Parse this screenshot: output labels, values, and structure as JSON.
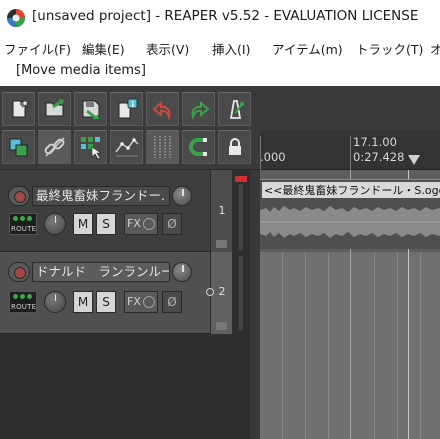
{
  "window": {
    "title": "[unsaved project] - REAPER v5.52 - EVALUATION LICENSE"
  },
  "menu": [
    {
      "label": "ファイル(F)"
    },
    {
      "label": "編集(E)"
    },
    {
      "label": "表示(V)"
    },
    {
      "label": "挿入(I)"
    },
    {
      "label": "アイテム(m)"
    },
    {
      "label": "トラック(T)"
    },
    {
      "label": "オ"
    }
  ],
  "undo_hint": "[Move media items]",
  "toolbar": {
    "row1": [
      "new-project-icon",
      "open-project-icon",
      "save-project-icon",
      "project-settings-icon",
      "undo-icon",
      "redo-icon",
      "metronome-icon"
    ],
    "row2": [
      "ripple-editing-icon",
      "item-grouping-icon",
      "snap-grid-icon",
      "envelope-points-icon",
      "grid-lines-icon",
      "snap-magnet-icon",
      "lock-icon"
    ],
    "accent_colors": {
      "green": "#3ba04a",
      "red": "#d8443a",
      "cyan": "#56c0d8"
    }
  },
  "tracks": [
    {
      "name": "最終鬼畜妹フランドー.",
      "number": "1",
      "route_label": "ROUTE",
      "mute_label": "M",
      "solo_label": "S",
      "fx_label": "FX",
      "phase_label": "Ø",
      "selected": false
    },
    {
      "name": "ドナルド　ランランルー",
      "number": "2",
      "route_label": "ROUTE",
      "mute_label": "M",
      "solo_label": "S",
      "fx_label": "FX",
      "phase_label": "Ø",
      "selected": true
    }
  ],
  "ruler": {
    "left_top": "",
    "left_bottom": ".000",
    "mark_measure": "17.1.00",
    "mark_time": "0:27.428"
  },
  "media_items": [
    {
      "track": 1,
      "label": "<<最終鬼畜妹フランドール・S.ogg"
    }
  ],
  "colors": {
    "title_bg": "#ffffff",
    "tcp_bg": "#3e3e3e",
    "arrange_bg": "#6e6e6e",
    "meter_clip": "#d03030"
  }
}
